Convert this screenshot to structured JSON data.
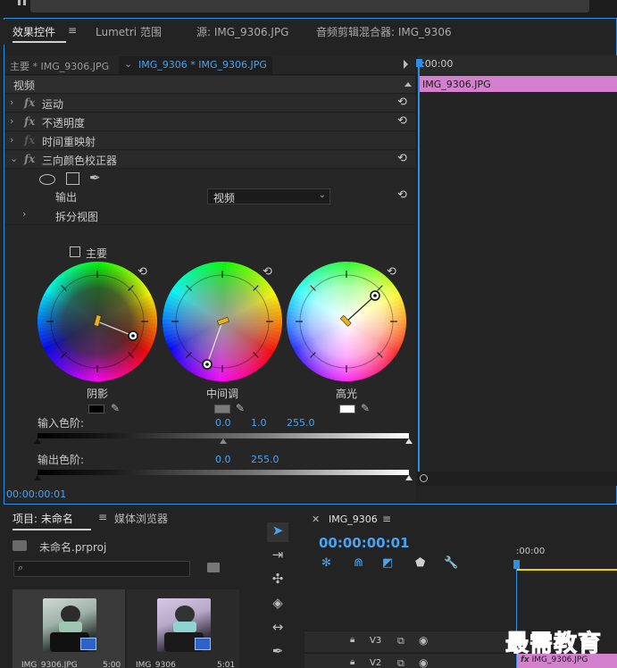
{
  "tabs": [
    {
      "label": "效果控件"
    },
    {
      "label": "Lumetri 范围"
    },
    {
      "label": "源: IMG_9306.JPG"
    },
    {
      "label": "音频剪辑混合器: IMG_9306"
    }
  ],
  "tab_menu_icon": "≡",
  "clip_header": {
    "master": "主要 * IMG_9306.JPG",
    "active": "IMG_9306 * IMG_9306.JPG",
    "timeline_time": ":00:00",
    "timeline_clip": "IMG_9306.JPG"
  },
  "sections": {
    "video": "视频",
    "motion": "运动",
    "opacity": "不透明度",
    "time_remap": "时间重映射",
    "three_way": "三向颜色校正器",
    "output_label": "输出",
    "output_value": "视频",
    "split_view": "拆分视图",
    "master_label": "主要"
  },
  "wheels": {
    "shadows": "阴影",
    "midtones": "中间调",
    "highlights": "高光"
  },
  "levels": {
    "input_label": "输入色阶:",
    "input_values": [
      "0.0",
      "1.0",
      "255.0"
    ],
    "output_label": "输出色阶:",
    "output_values": [
      "0.0",
      "255.0"
    ]
  },
  "bottom_timecode": "00:00:00:01",
  "project": {
    "tab_project": "项目: 未命名",
    "tab_media": "媒体浏览器",
    "file": "未命名.prproj",
    "search_placeholder": "",
    "items": [
      {
        "name": "IMG_9306.JPG",
        "duration": "5:00"
      },
      {
        "name": "IMG_9306",
        "duration": "5:01"
      }
    ]
  },
  "sequence": {
    "name": "IMG_9306",
    "timecode": "00:00:00:01",
    "ruler_time": ":00:00",
    "tracks": [
      "V3",
      "V2"
    ],
    "clip": "IMG_9306.JPG"
  },
  "watermark": "最需教育",
  "colors": {
    "accent": "#2f8ee0",
    "clip_pink": "#d57fcf",
    "timecode_blue": "#4aa3f0"
  }
}
